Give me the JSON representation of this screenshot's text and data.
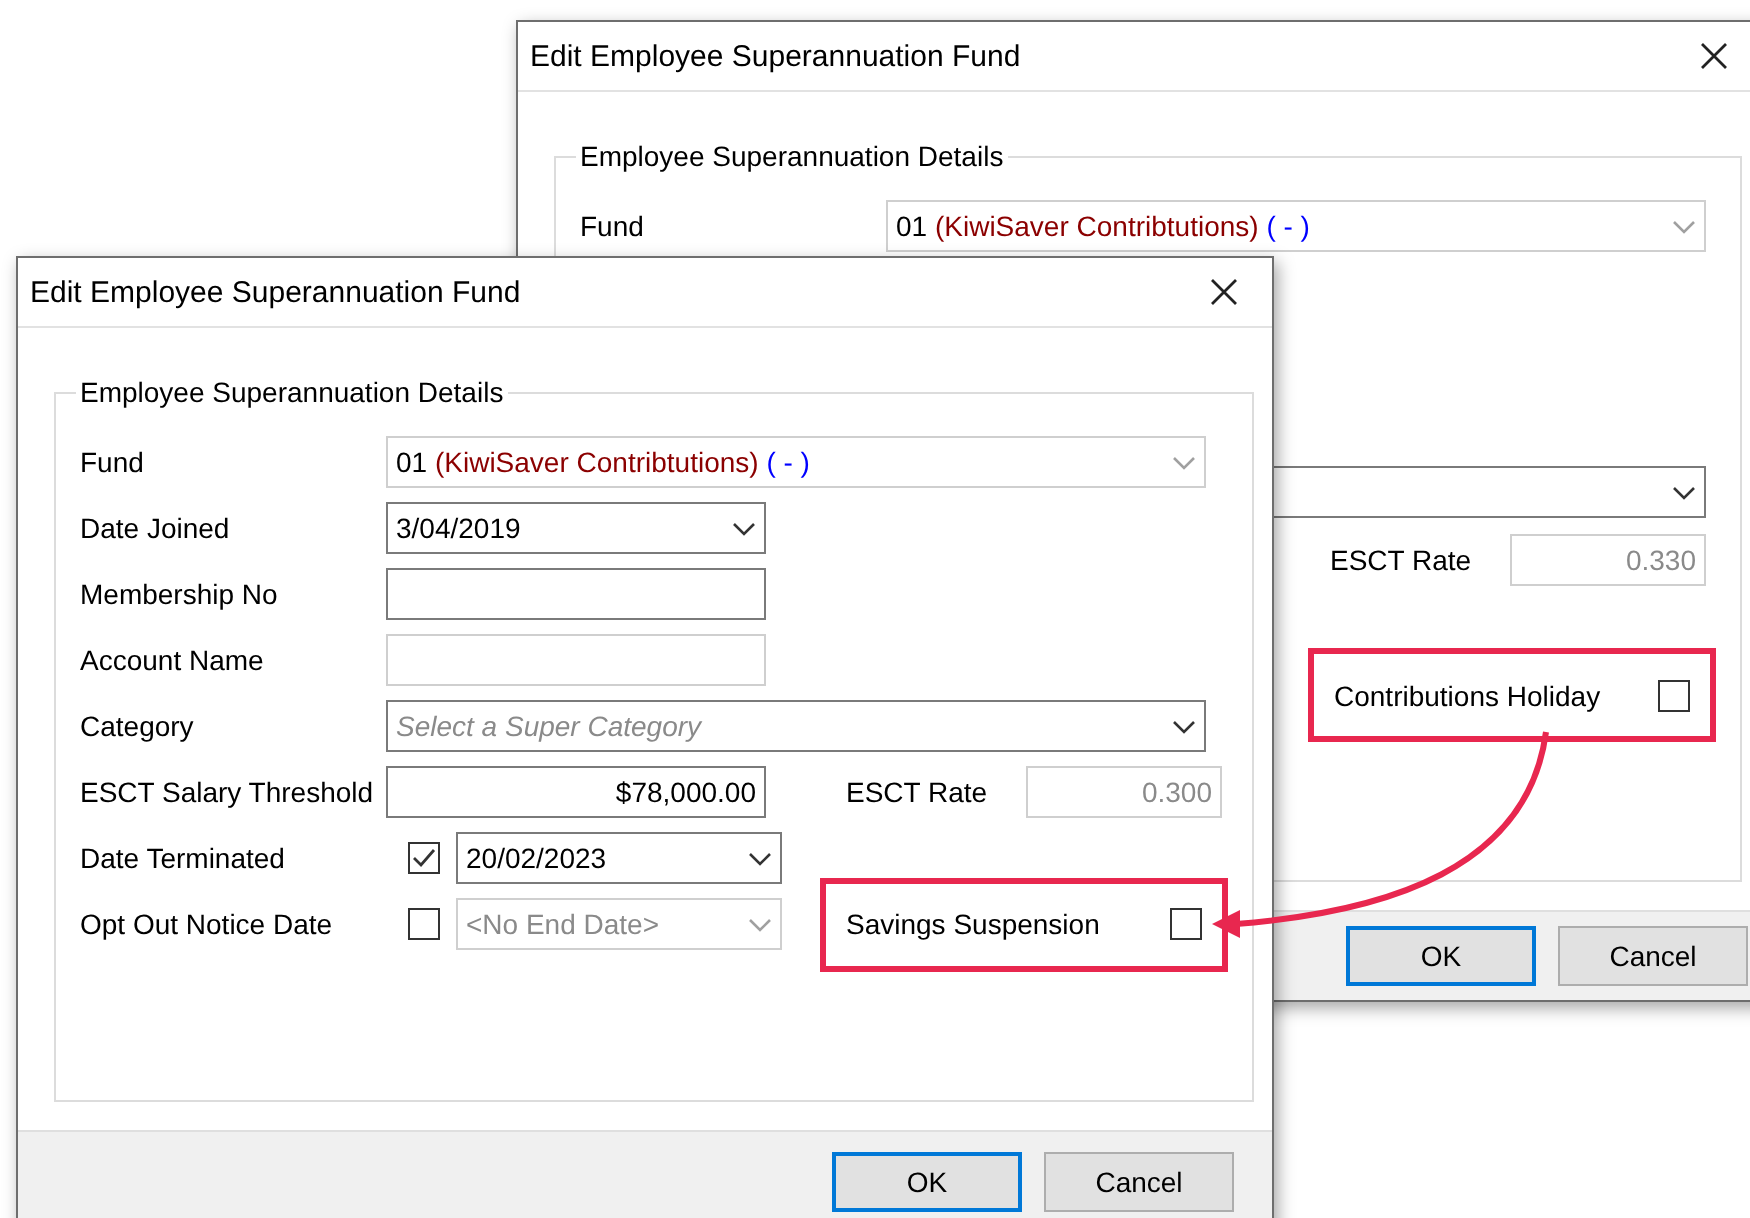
{
  "back_window": {
    "title": "Edit Employee Superannuation Fund",
    "group_title": "Employee Superannuation Details",
    "fund": {
      "label": "Fund",
      "disabled": true,
      "value_parts": [
        {
          "text": "01 ",
          "color": "#000000"
        },
        {
          "text": "(KiwiSaver Contribtutions) ",
          "color": "#8b0000"
        },
        {
          "text": "( - )",
          "color": "#0000ff"
        }
      ]
    },
    "esct_rate": {
      "label": "ESCT Rate",
      "value": "0.330",
      "disabled": true
    },
    "contributions_holiday": {
      "label": "Contributions Holiday",
      "checked": false,
      "highlighted": true
    },
    "buttons": [
      {
        "label": "OK",
        "default": true
      },
      {
        "label": "Cancel",
        "default": false
      }
    ]
  },
  "front_window": {
    "title": "Edit Employee Superannuation Fund",
    "group_title": "Employee Superannuation Details",
    "fields": [
      {
        "kind": "combo",
        "label": "Fund",
        "disabled": true,
        "wide": true,
        "value_parts": [
          {
            "text": "01 ",
            "color": "#000000"
          },
          {
            "text": "(KiwiSaver Contribtutions) ",
            "color": "#8b0000"
          },
          {
            "text": "( - )",
            "color": "#0000ff"
          }
        ]
      },
      {
        "kind": "date",
        "label": "Date Joined",
        "disabled": false,
        "value": "3/04/2019"
      },
      {
        "kind": "text",
        "label": "Membership No",
        "disabled": false
      },
      {
        "kind": "text",
        "label": "Account Name",
        "disabled": true
      },
      {
        "kind": "combo",
        "label": "Category",
        "disabled": false,
        "wide": true,
        "placeholder": "Select a Super Category"
      },
      {
        "kind": "text",
        "label": "ESCT Salary Threshold",
        "disabled": false,
        "value": "$78,000.00",
        "side": {
          "kind": "readonly",
          "label": "ESCT Rate",
          "value": "0.300"
        }
      },
      {
        "kind": "checked_date",
        "label": "Date Terminated",
        "checked": true,
        "disabled": false,
        "value": "20/02/2023"
      },
      {
        "kind": "checked_date",
        "label": "Opt Out Notice Date",
        "checked": false,
        "disabled": true,
        "value": "<No End Date>",
        "side": {
          "kind": "checkbox",
          "label": "Savings Suspension",
          "checked": false,
          "highlighted": true
        }
      }
    ],
    "buttons": [
      {
        "label": "OK",
        "default": true
      },
      {
        "label": "Cancel",
        "default": false
      }
    ]
  },
  "annotation": {
    "kind": "arrow"
  }
}
